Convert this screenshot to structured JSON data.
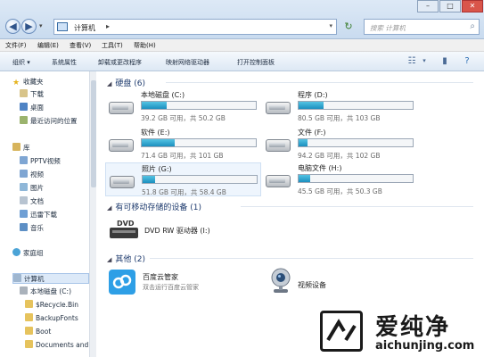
{
  "window": {
    "address_crumb": "计算机",
    "search_placeholder": "搜索 计算机"
  },
  "menu": [
    "文件(F)",
    "编辑(E)",
    "查看(V)",
    "工具(T)",
    "帮助(H)"
  ],
  "toolbar": [
    "组织 ▾",
    "系统属性",
    "卸载或更改程序",
    "映射网络驱动器",
    "打开控制面板"
  ],
  "nav": {
    "favorites_header": "收藏夹",
    "favorites": [
      "下载",
      "桌面",
      "最近访问的位置"
    ],
    "library_header": "库",
    "libraries": [
      "PPTV视频",
      "视频",
      "图片",
      "文档",
      "迅雷下载",
      "音乐"
    ],
    "homegroup": "家庭组",
    "computer_header": "计算机",
    "computer_items": [
      "本地磁盘 (C:)",
      "$Recycle.Bin",
      "BackupFonts",
      "Boot",
      "Documents and"
    ]
  },
  "groups": {
    "hdd": "硬盘 (6)",
    "removable": "有可移动存储的设备 (1)",
    "other": "其他 (2)"
  },
  "drives": [
    {
      "name": "本地磁盘 (C:)",
      "info": "39.2 GB 可用，共 50.2 GB",
      "used_fraction": 0.22
    },
    {
      "name": "程序 (D:)",
      "info": "80.5 GB 可用，共 103 GB",
      "used_fraction": 0.22
    },
    {
      "name": "软件 (E:)",
      "info": "71.4 GB 可用，共 101 GB",
      "used_fraction": 0.29
    },
    {
      "name": "文件 (F:)",
      "info": "94.2 GB 可用，共 102 GB",
      "used_fraction": 0.08
    },
    {
      "name": "照片 (G:)",
      "info": "51.8 GB 可用，共 58.4 GB",
      "used_fraction": 0.11
    },
    {
      "name": "电脑文件 (H:)",
      "info": "45.5 GB 可用，共 50.3 GB",
      "used_fraction": 0.1
    }
  ],
  "dvd": {
    "name": "DVD RW 驱动器 (I:)"
  },
  "other_items": [
    {
      "name": "百度云管家",
      "sub": "双击运行百度云管家"
    },
    {
      "name": "视频设备",
      "sub": ""
    }
  ],
  "watermark": {
    "brand": "爱纯净",
    "url": "aichunjing.com"
  }
}
